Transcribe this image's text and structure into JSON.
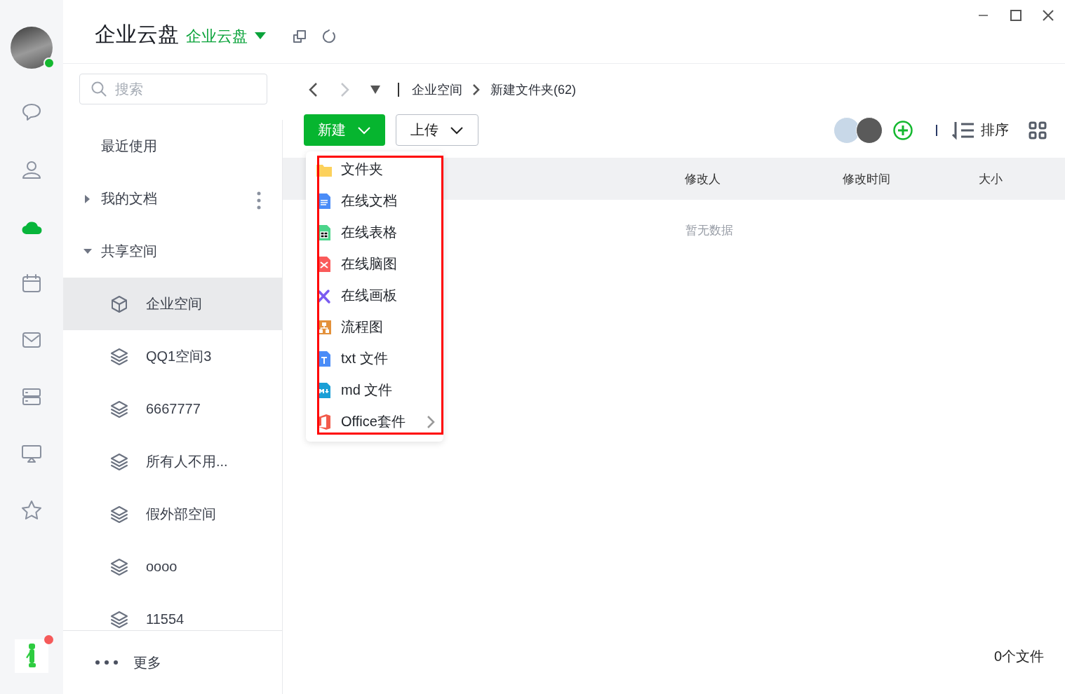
{
  "app": {
    "title": "企业云盘",
    "workspace": "企业云盘"
  },
  "rail": {
    "items": [
      {
        "kind": "chat",
        "selected": false
      },
      {
        "kind": "contacts",
        "selected": false
      },
      {
        "kind": "cloud",
        "selected": true
      },
      {
        "kind": "calendar",
        "selected": false
      },
      {
        "kind": "mail",
        "selected": false
      },
      {
        "kind": "server",
        "selected": false
      },
      {
        "kind": "screen",
        "selected": false
      },
      {
        "kind": "star",
        "selected": false
      }
    ],
    "notification": true
  },
  "sidebar": {
    "search": {
      "placeholder": "搜索"
    },
    "items": [
      {
        "label": "最近使用",
        "kind": "plain"
      },
      {
        "label": "我的文档",
        "kind": "group",
        "expanded": false
      },
      {
        "label": "共享空间",
        "kind": "group",
        "expanded": true,
        "children": [
          {
            "label": "企业空间",
            "kind": "enterprise",
            "selected": true
          },
          {
            "label": "QQ1空间3",
            "kind": "space",
            "selected": false
          },
          {
            "label": "6667777",
            "kind": "space",
            "selected": false
          },
          {
            "label": "所有人不用...",
            "kind": "space",
            "selected": false
          },
          {
            "label": "假外部空间",
            "kind": "space",
            "selected": false
          },
          {
            "label": "oooo",
            "kind": "space",
            "selected": false
          },
          {
            "label": "11554",
            "kind": "space",
            "selected": false
          }
        ]
      }
    ],
    "more": "更多"
  },
  "breadcrumb": [
    "企业空间",
    "新建文件夹(62)"
  ],
  "toolbar": {
    "new": "新建",
    "upload": "上传",
    "sort": "排序"
  },
  "menu": {
    "items": [
      {
        "label": "文件夹",
        "kind": "folder"
      },
      {
        "label": "在线文档",
        "kind": "doc"
      },
      {
        "label": "在线表格",
        "kind": "sheet"
      },
      {
        "label": "在线脑图",
        "kind": "mindmap"
      },
      {
        "label": "在线画板",
        "kind": "board"
      },
      {
        "label": "流程图",
        "kind": "flow"
      },
      {
        "label": "txt 文件",
        "kind": "txt"
      },
      {
        "label": "md 文件",
        "kind": "md"
      },
      {
        "label": "Office套件",
        "kind": "office",
        "submenu": true
      }
    ]
  },
  "table": {
    "columns": [
      "修改人",
      "修改时间",
      "大小"
    ],
    "empty": "暂无数据"
  },
  "status_bar": "0个文件"
}
